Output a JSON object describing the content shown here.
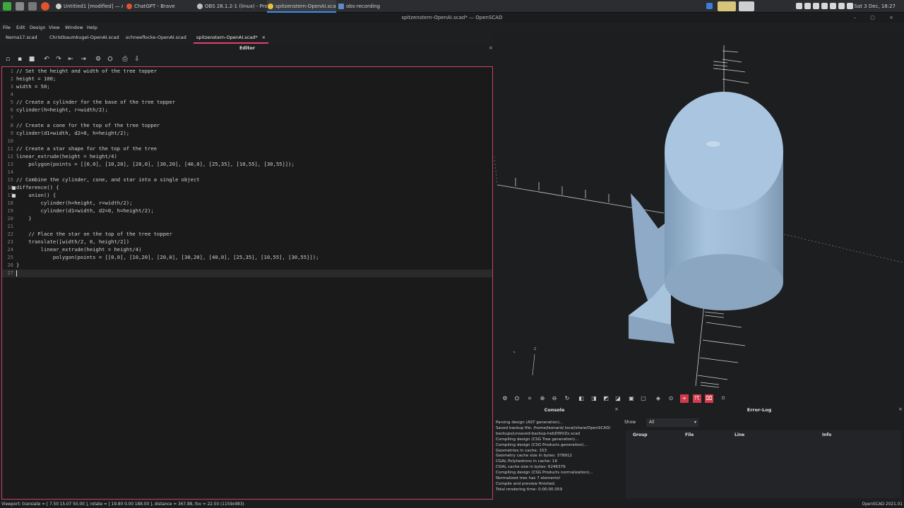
{
  "taskbar": {
    "tasks": [
      {
        "label": "Untitled1 [modified] — A…",
        "color": "#cfcfcf"
      },
      {
        "label": "ChatGPT - Brave",
        "color": "#e0542f"
      },
      {
        "label": "OBS 28.1.2-1 (linux) - Profi…",
        "color": "#bfbfbf"
      },
      {
        "label": "spitzenstern-OpenAI.scad…",
        "color": "#e8c33a"
      },
      {
        "label": "obs-recording",
        "color": "#5b8cc9"
      }
    ],
    "clock": "Sat 3 Dec, 18:27"
  },
  "window": {
    "title": "spitzenstern-OpenAI.scad* — OpenSCAD",
    "controls": "– ▢ ×"
  },
  "menu": [
    "File",
    "Edit",
    "Design",
    "View",
    "Window",
    "Help"
  ],
  "file_tabs": [
    {
      "label": "Nema17.scad",
      "active": false
    },
    {
      "label": "Christbaumkugel-OpenAI.scad",
      "active": false
    },
    {
      "label": "schneeflocke-OpenAI.scad",
      "active": false
    },
    {
      "label": "spitzenstern-OpenAI.scad*",
      "active": true
    }
  ],
  "tab_close": "×",
  "editor": {
    "title": "Editor",
    "close": "×",
    "toolbar_icons": [
      "new-file-icon",
      "open-file-icon",
      "save-icon",
      "undo-icon",
      "redo-icon",
      "unindent-icon",
      "indent-icon",
      "preview-icon",
      "render-icon",
      "export-stl-icon",
      "send-to-print-icon"
    ],
    "lines": [
      "// Set the height and width of the tree topper",
      "height = 100;",
      "width = 50;",
      "",
      "// Create a cylinder for the base of the tree topper",
      "cylinder(h=height, r=width/2);",
      "",
      "// Create a cone for the top of the tree topper",
      "cylinder(d1=width, d2=0, h=height/2);",
      "",
      "// Create a star shape for the top of the tree",
      "linear_extrude(height = height/4)",
      "    polygon(points = [[0,0], [10,20], [20,0], [30,20], [40,0], [25,35], [10,55], [30,55]]);",
      "",
      "// Combine the cylinder, cone, and star into a single object",
      "difference() {",
      "    union() {",
      "        cylinder(h=height, r=width/2);",
      "        cylinder(d1=width, d2=0, h=height/2);",
      "    }",
      "",
      "    // Place the star on the top of the tree topper",
      "    translate([width/2, 0, height/2])",
      "        linear_extrude(height = height/4)",
      "            polygon(points = [[0,0], [10,20], [20,0], [30,20], [40,0], [25,35], [10,55], [30,55]]);",
      "}",
      ""
    ],
    "cursor_line": 27
  },
  "viewport": {
    "axis_label_z": "z",
    "model_color": "#a9c5e0",
    "toolbar_icons": [
      "preview-icon",
      "render-icon",
      "view-all-icon",
      "zoom-in-icon",
      "zoom-out-icon",
      "reset-view-icon",
      "view-right-icon",
      "view-top-icon",
      "view-bottom-icon",
      "view-left-icon",
      "view-front-icon",
      "view-back-icon",
      "view-diagonal-icon",
      "view-center-icon",
      "perspective-icon",
      "show-axes-icon",
      "show-edges-icon",
      "crosshairs-icon"
    ]
  },
  "console": {
    "title": "Console",
    "close": "×",
    "lines": [
      "Parsing design (AST generation)...",
      "Saved backup file: /home/leonard/.local/share/OpenSCAD/",
      "backups/unsaved-backup-hebDWVZx.scad",
      "Compiling design (CSG Tree generation)...",
      "Compiling design (CSG Products generation)...",
      "Geometries in cache: 153",
      "Geometry cache size in bytes: 378912",
      "CGAL Polyhedrons in cache: 16",
      "CGAL cache size in bytes: 6246376",
      "Compiling design (CSG Products normalization)...",
      "Normalized tree has 7 elements!",
      "Compile and preview finished.",
      "Total rendering time: 0:00:00.059"
    ]
  },
  "error_log": {
    "title": "Error-Log",
    "close": "×",
    "show_label": "Show",
    "show_value": "All",
    "columns": [
      "Group",
      "File",
      "Line",
      "Info"
    ]
  },
  "status": {
    "viewport": "Viewport: translate = [ 7.50 15.07 50.00 ], rotate = [ 19.80 0.00 188.00 ], distance = 367.88, fov = 22.50 (1159x983)",
    "version": "OpenSCAD 2021.01"
  }
}
